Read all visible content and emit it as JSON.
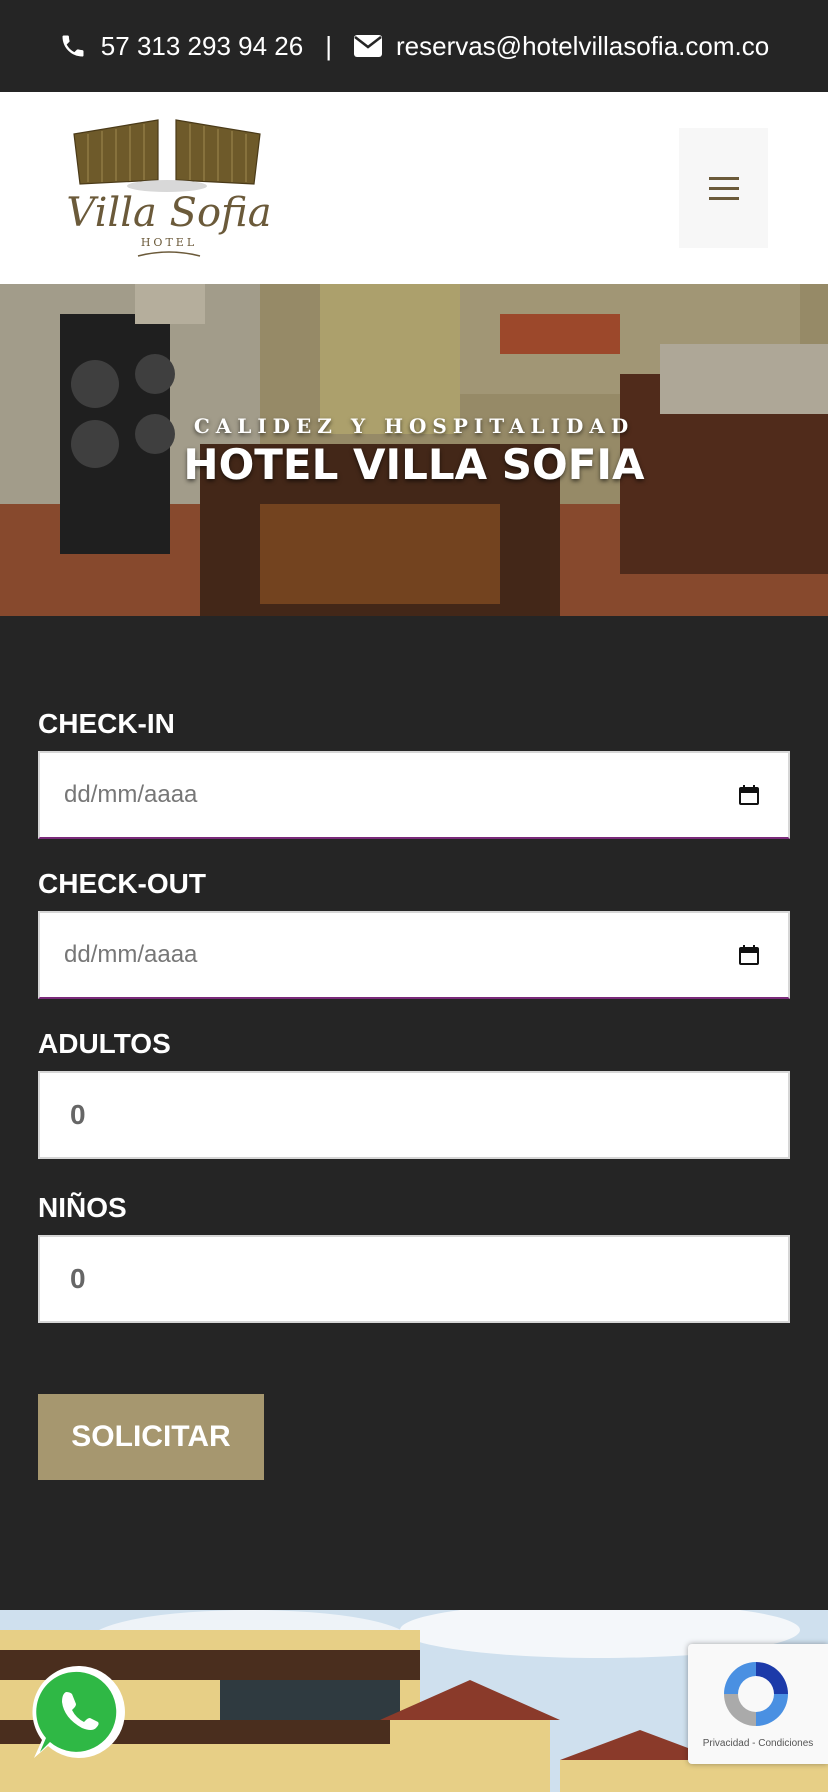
{
  "topbar": {
    "phone": "57 313 293 94 26",
    "separator": "|",
    "email": "reservas@hotelvillasofia.com.co"
  },
  "header": {
    "logo_icons": [
      "gate-logo"
    ],
    "menu_icon": "hamburger-icon"
  },
  "hero": {
    "subtitle": "CALIDEZ Y HOSPITALIDAD",
    "title": "HOTEL VILLA SOFIA"
  },
  "form": {
    "checkin_label": "CHECK-IN",
    "checkin_placeholder": "dd/mm/aaaa",
    "checkout_label": "CHECK-OUT",
    "checkout_placeholder": "dd/mm/aaaa",
    "adults_label": "ADULTOS",
    "adults_value": "0",
    "children_label": "NIÑOS",
    "children_value": "0",
    "submit_label": "SOLICITAR"
  },
  "recaptcha": {
    "footer_text": "Privacidad - Condiciones"
  },
  "colors": {
    "background": "#252525",
    "button": "#a6976f",
    "brand_brown": "#6b5a3a"
  }
}
